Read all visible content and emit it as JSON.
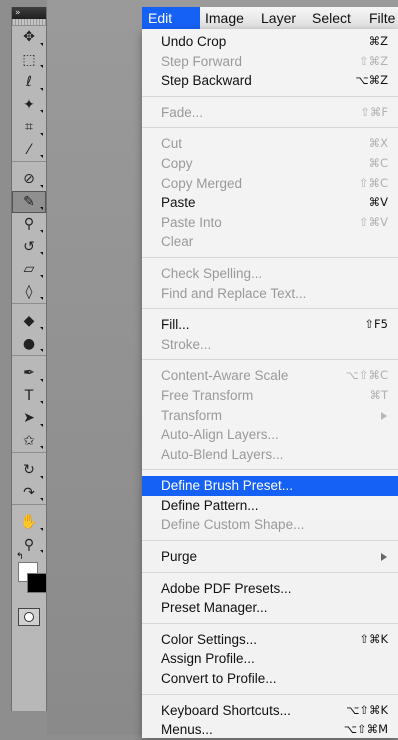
{
  "menubar": {
    "items": [
      "Edit",
      "Image",
      "Layer",
      "Select",
      "Filte"
    ],
    "active_index": 0
  },
  "toolbar": {
    "collapse_glyph": "»",
    "tools": [
      {
        "name": "move-tool-icon",
        "glyph": "✥"
      },
      {
        "name": "marquee-tool-icon",
        "glyph": "⬚"
      },
      {
        "name": "lasso-tool-icon",
        "glyph": "ℓ"
      },
      {
        "name": "magic-wand-tool-icon",
        "glyph": "✦"
      },
      {
        "name": "crop-tool-icon",
        "glyph": "⌗"
      },
      {
        "name": "eyedropper-tool-icon",
        "glyph": "⁄"
      },
      {
        "name": "healing-brush-tool-icon",
        "glyph": "⊘"
      },
      {
        "name": "brush-tool-icon",
        "glyph": "✎",
        "active": true
      },
      {
        "name": "clone-stamp-tool-icon",
        "glyph": "⚲"
      },
      {
        "name": "history-brush-tool-icon",
        "glyph": "↺"
      },
      {
        "name": "eraser-tool-icon",
        "glyph": "▱"
      },
      {
        "name": "paint-bucket-tool-icon",
        "glyph": "◊"
      },
      {
        "name": "blur-tool-icon",
        "glyph": "◆"
      },
      {
        "name": "dodge-tool-icon",
        "glyph": "●"
      },
      {
        "name": "pen-tool-icon",
        "glyph": "✒"
      },
      {
        "name": "type-tool-icon",
        "glyph": "T"
      },
      {
        "name": "path-selection-tool-icon",
        "glyph": "➤"
      },
      {
        "name": "custom-shape-tool-icon",
        "glyph": "✩"
      },
      {
        "name": "3d-rotate-tool-icon",
        "glyph": "↻"
      },
      {
        "name": "3d-orbit-tool-icon",
        "glyph": "↷"
      },
      {
        "name": "hand-tool-icon",
        "glyph": "✋"
      },
      {
        "name": "zoom-tool-icon",
        "glyph": "⚲"
      }
    ],
    "swap_glyph": "↰",
    "colors": {
      "foreground": "#ffffff",
      "background": "#000000"
    }
  },
  "menu": {
    "items": [
      {
        "label": "Undo Crop",
        "shortcut": "⌘Z",
        "enabled": true
      },
      {
        "label": "Step Forward",
        "shortcut": "⇧⌘Z",
        "enabled": false
      },
      {
        "label": "Step Backward",
        "shortcut": "⌥⌘Z",
        "enabled": true
      },
      {
        "sep": true
      },
      {
        "label": "Fade...",
        "shortcut": "⇧⌘F",
        "enabled": false
      },
      {
        "sep": true
      },
      {
        "label": "Cut",
        "shortcut": "⌘X",
        "enabled": false
      },
      {
        "label": "Copy",
        "shortcut": "⌘C",
        "enabled": false
      },
      {
        "label": "Copy Merged",
        "shortcut": "⇧⌘C",
        "enabled": false
      },
      {
        "label": "Paste",
        "shortcut": "⌘V",
        "enabled": true
      },
      {
        "label": "Paste Into",
        "shortcut": "⇧⌘V",
        "enabled": false
      },
      {
        "label": "Clear",
        "shortcut": "",
        "enabled": false
      },
      {
        "sep": true
      },
      {
        "label": "Check Spelling...",
        "shortcut": "",
        "enabled": false
      },
      {
        "label": "Find and Replace Text...",
        "shortcut": "",
        "enabled": false
      },
      {
        "sep": true
      },
      {
        "label": "Fill...",
        "shortcut": "⇧F5",
        "enabled": true
      },
      {
        "label": "Stroke...",
        "shortcut": "",
        "enabled": false
      },
      {
        "sep": true
      },
      {
        "label": "Content-Aware Scale",
        "shortcut": "⌥⇧⌘C",
        "enabled": false
      },
      {
        "label": "Free Transform",
        "shortcut": "⌘T",
        "enabled": false
      },
      {
        "label": "Transform",
        "shortcut": "",
        "enabled": false,
        "submenu": true
      },
      {
        "label": "Auto-Align Layers...",
        "shortcut": "",
        "enabled": false
      },
      {
        "label": "Auto-Blend Layers...",
        "shortcut": "",
        "enabled": false
      },
      {
        "sep": true
      },
      {
        "label": "Define Brush Preset...",
        "shortcut": "",
        "enabled": true,
        "highlighted": true
      },
      {
        "label": "Define Pattern...",
        "shortcut": "",
        "enabled": true
      },
      {
        "label": "Define Custom Shape...",
        "shortcut": "",
        "enabled": false
      },
      {
        "sep": true
      },
      {
        "label": "Purge",
        "shortcut": "",
        "enabled": true,
        "submenu": true
      },
      {
        "sep": true
      },
      {
        "label": "Adobe PDF Presets...",
        "shortcut": "",
        "enabled": true
      },
      {
        "label": "Preset Manager...",
        "shortcut": "",
        "enabled": true
      },
      {
        "sep": true
      },
      {
        "label": "Color Settings...",
        "shortcut": "⇧⌘K",
        "enabled": true
      },
      {
        "label": "Assign Profile...",
        "shortcut": "",
        "enabled": true
      },
      {
        "label": "Convert to Profile...",
        "shortcut": "",
        "enabled": true
      },
      {
        "sep": true
      },
      {
        "label": "Keyboard Shortcuts...",
        "shortcut": "⌥⇧⌘K",
        "enabled": true
      },
      {
        "label": "Menus...",
        "shortcut": "⌥⇧⌘M",
        "enabled": true
      }
    ]
  },
  "colors": {
    "accent": "#1560f5"
  }
}
